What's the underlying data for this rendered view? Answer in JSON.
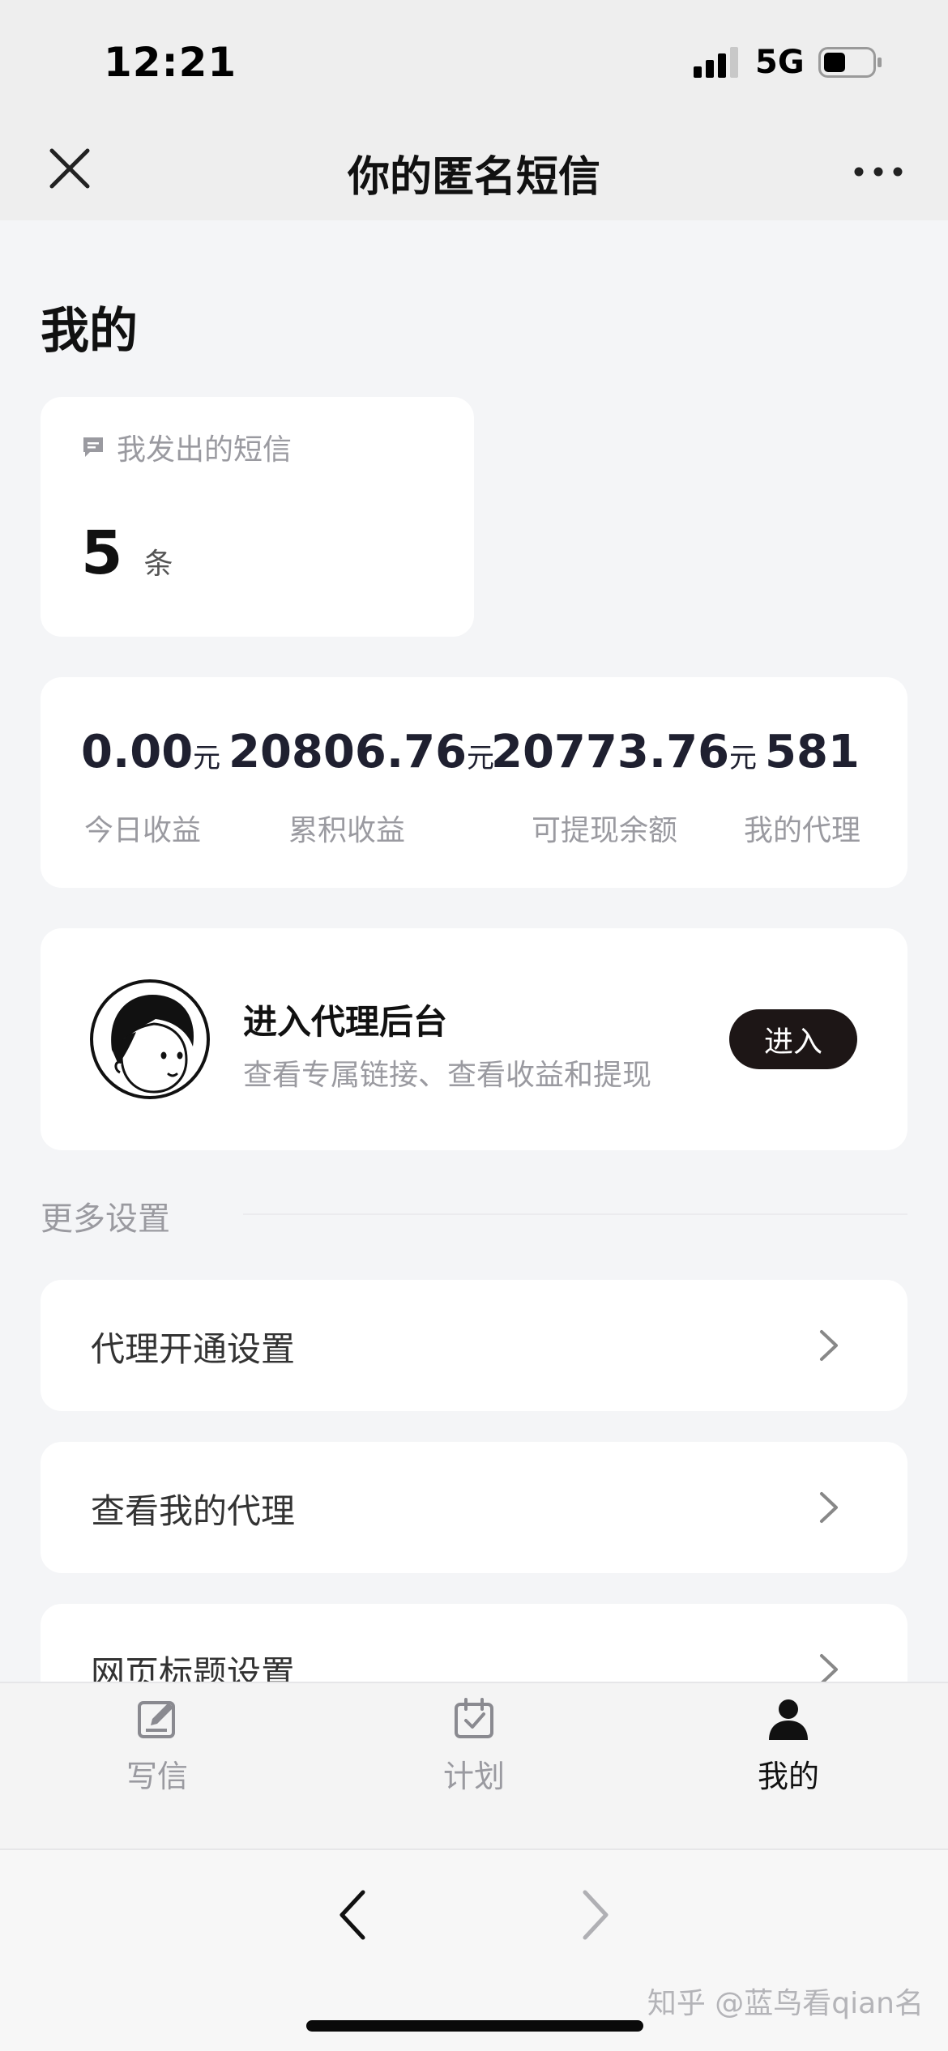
{
  "status_bar": {
    "time": "12:21",
    "network": "5G"
  },
  "nav": {
    "title": "你的匿名短信"
  },
  "page": {
    "title": "我的"
  },
  "sms_card": {
    "label": "我发出的短信",
    "count": "5",
    "unit": "条"
  },
  "stats": [
    {
      "value": "0.00",
      "unit": "元",
      "label": "今日收益"
    },
    {
      "value": "20806.76",
      "unit": "元",
      "label": "累积收益"
    },
    {
      "value": "20773.76",
      "unit": "元",
      "label": "可提现余额"
    },
    {
      "value": "581",
      "unit": "",
      "label": "我的代理"
    }
  ],
  "agent_card": {
    "title": "进入代理后台",
    "description": "查看专属链接、查看收益和提现",
    "button_label": "进入"
  },
  "settings": {
    "section_title": "更多设置",
    "items": [
      {
        "label": "代理开通设置"
      },
      {
        "label": "查看我的代理"
      },
      {
        "label": "网页标题设置"
      }
    ]
  },
  "tabs": [
    {
      "label": "写信",
      "icon": "write-icon"
    },
    {
      "label": "计划",
      "icon": "calendar-check-icon"
    },
    {
      "label": "我的",
      "icon": "person-icon",
      "active": true
    }
  ],
  "watermark": "知乎 @蓝鸟看qian名"
}
